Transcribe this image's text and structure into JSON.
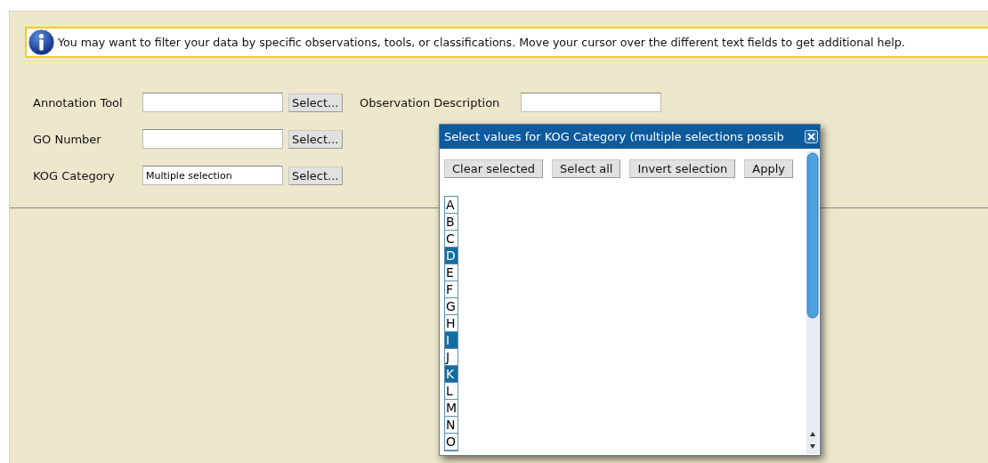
{
  "info": {
    "text": "You may want to filter your data by specific observations, tools, or classifications. Move your cursor over the different text fields to get additional help."
  },
  "fields": [
    {
      "label": "Annotation Tool",
      "button": "Select..."
    },
    {
      "label": "GO Number",
      "button": "Select..."
    },
    {
      "label": "KOG Category",
      "value": "Multiple selection",
      "button": "Select..."
    }
  ],
  "observation": {
    "label": "Observation Description"
  },
  "dialog": {
    "title": "Select values for KOG Category (multiple selections possib",
    "buttons": [
      "Clear selected",
      "Select all",
      "Invert selection",
      "Apply"
    ],
    "options": [
      {
        "label": "A",
        "selected": false
      },
      {
        "label": "B",
        "selected": false
      },
      {
        "label": "C",
        "selected": false
      },
      {
        "label": "D",
        "selected": true
      },
      {
        "label": "E",
        "selected": false
      },
      {
        "label": "F",
        "selected": false
      },
      {
        "label": "G",
        "selected": false
      },
      {
        "label": "H",
        "selected": false
      },
      {
        "label": "I",
        "selected": true
      },
      {
        "label": "J",
        "selected": false
      },
      {
        "label": "K",
        "selected": true
      },
      {
        "label": "L",
        "selected": false
      },
      {
        "label": "M",
        "selected": false
      },
      {
        "label": "N",
        "selected": false
      },
      {
        "label": "O",
        "selected": false
      }
    ]
  }
}
